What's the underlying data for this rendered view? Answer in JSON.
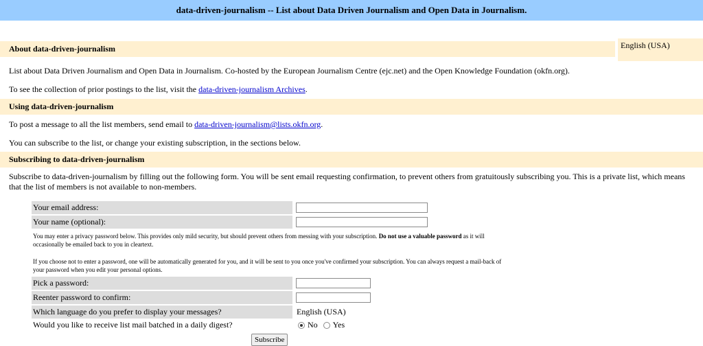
{
  "title": "data-driven-journalism -- List about Data Driven Journalism and Open Data in Journalism.",
  "language_box": "English (USA)",
  "about": {
    "heading": "About data-driven-journalism",
    "description": "List about Data Driven Journalism and Open Data in Journalism. Co-hosted by the European Journalism Centre (ejc.net) and the Open Knowledge Foundation (okfn.org).",
    "archives_prefix": "To see the collection of prior postings to the list, visit the ",
    "archives_link": "data-driven-journalism Archives",
    "archives_suffix": "."
  },
  "using": {
    "heading": "Using data-driven-journalism",
    "post_prefix": "To post a message to all the list members, send email to ",
    "post_email": "data-driven-journalism@lists.okfn.org",
    "post_suffix": ".",
    "subscribe_info": "You can subscribe to the list, or change your existing subscription, in the sections below."
  },
  "subscribing": {
    "heading": "Subscribing to data-driven-journalism",
    "intro": "Subscribe to data-driven-journalism by filling out the following form. You will be sent email requesting confirmation, to prevent others from gratuitously subscribing you. This is a private list, which means that the list of members is not available to non-members."
  },
  "form": {
    "email_label": "Your email address:",
    "email_value": "",
    "name_label": "Your name (optional):",
    "name_value": "",
    "password_note_1": "You may enter a privacy password below. This provides only mild security, but should prevent others from messing with your subscription. ",
    "password_note_bold": "Do not use a valuable password",
    "password_note_2": " as it will occasionally be emailed back to you in cleartext.",
    "password_note_3": "If you choose not to enter a password, one will be automatically generated for you, and it will be sent to you once you've confirmed your subscription. You can always request a mail-back of your password when you edit your personal options.",
    "pick_password_label": "Pick a password:",
    "reenter_password_label": "Reenter password to confirm:",
    "language_label": "Which language do you prefer to display your messages?",
    "language_value": "English (USA)",
    "digest_label": "Would you like to receive list mail batched in a daily digest?",
    "digest_options": [
      "No",
      "Yes"
    ],
    "digest_selected": "No",
    "subscribe_button": "Subscribe"
  }
}
